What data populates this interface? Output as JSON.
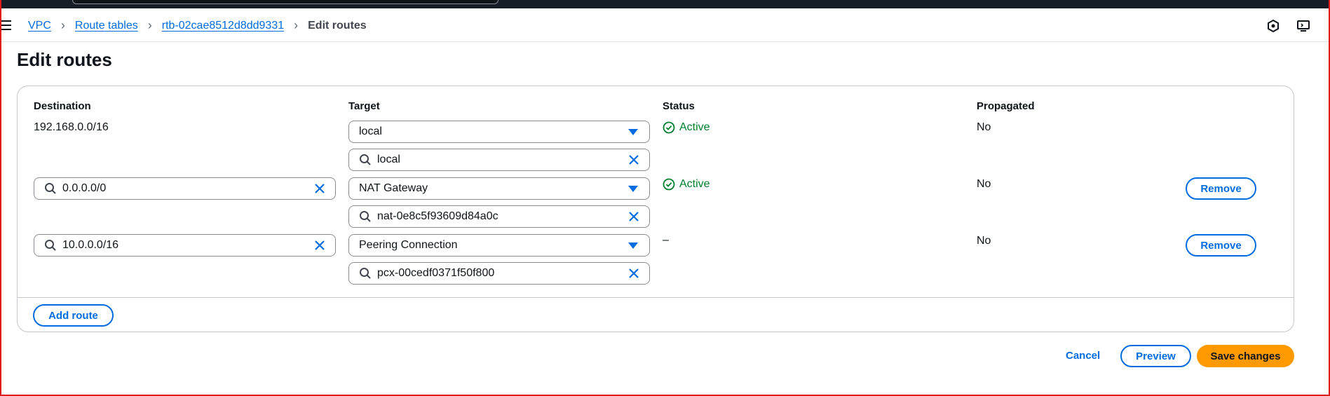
{
  "breadcrumb": {
    "items": [
      "VPC",
      "Route tables",
      "rtb-02cae8512d8dd9331"
    ],
    "current": "Edit routes"
  },
  "header": {
    "right_icons": [
      "cloudshell-icon",
      "notifications-icon"
    ]
  },
  "page": {
    "title": "Edit routes"
  },
  "table": {
    "columns": [
      "Destination",
      "Target",
      "Status",
      "Propagated"
    ],
    "rows": [
      {
        "destination": "192.168.0.0/16",
        "target_type": "local",
        "target_value": "local",
        "status": "Active",
        "propagated": "No"
      },
      {
        "destination": "0.0.0.0/0",
        "target_type": "NAT Gateway",
        "target_value": "nat-0e8c5f93609d84a0c",
        "status": "Active",
        "propagated": "No",
        "remove_label": "Remove"
      },
      {
        "destination": "10.0.0.0/16",
        "target_type": "Peering Connection",
        "target_value": "pcx-00cedf0371f50f800",
        "status": "–",
        "propagated": "No",
        "remove_label": "Remove"
      }
    ]
  },
  "actions": {
    "add_route": "Add route",
    "cancel": "Cancel",
    "preview": "Preview",
    "save": "Save changes"
  },
  "colors": {
    "link": "#006ce0",
    "success": "#00802f",
    "primary_button": "#ff9900",
    "frame": "#e01b1b"
  }
}
